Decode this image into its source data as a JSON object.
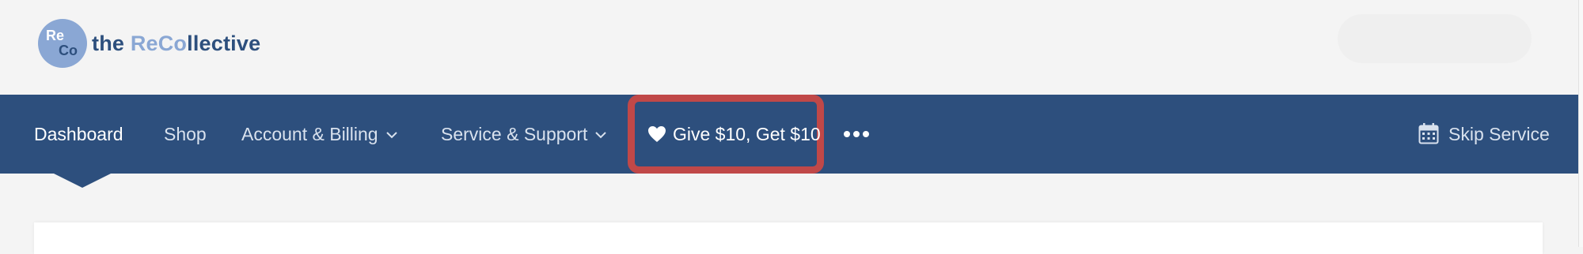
{
  "brand": {
    "logo_re": "Re",
    "logo_co": "Co",
    "name_part1": "the ",
    "name_part2": "ReCo",
    "name_part3": "llective"
  },
  "nav": {
    "dashboard": "Dashboard",
    "shop": "Shop",
    "account_billing": "Account & Billing",
    "service_support": "Service & Support",
    "give_get": "Give $10, Get $10",
    "skip_service": "Skip Service"
  },
  "icons": {
    "heart": "heart-icon",
    "more": "more-dots-icon",
    "calendar": "calendar-icon",
    "caret": "chevron-down-icon"
  },
  "colors": {
    "nav_bg": "#2d4f7d",
    "highlight": "#c04848",
    "page_bg": "#f4f4f4",
    "brand_light": "#8aa7d4"
  }
}
